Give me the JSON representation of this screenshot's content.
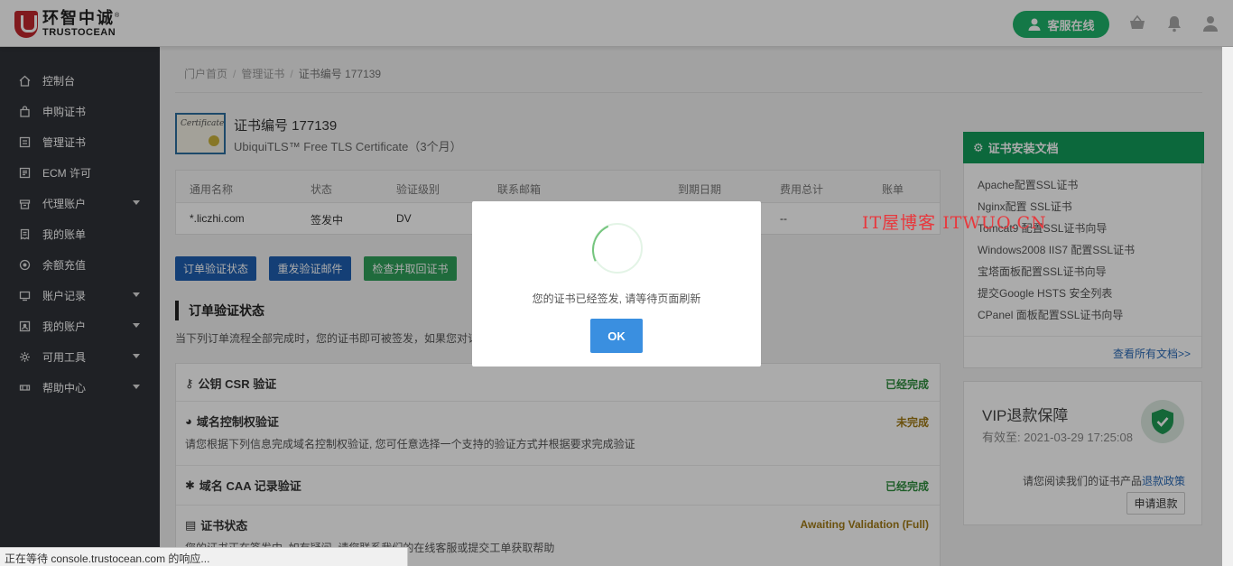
{
  "header": {
    "logo_cn": "环智中诚",
    "logo_en": "TRUSTOCEAN",
    "logo_mark": "®",
    "support_label": "客服在线",
    "icons": [
      "user-icon",
      "basket-icon",
      "bell-icon",
      "account-icon"
    ]
  },
  "sidebar": {
    "items": [
      {
        "label": "控制台",
        "icon": "home-icon",
        "dropdown": false
      },
      {
        "label": "申购证书",
        "icon": "bag-icon",
        "dropdown": false
      },
      {
        "label": "管理证书",
        "icon": "certificate-icon",
        "dropdown": false
      },
      {
        "label": "ECM 许可",
        "icon": "license-icon",
        "dropdown": false
      },
      {
        "label": "代理账户",
        "icon": "agent-icon",
        "dropdown": true
      },
      {
        "label": "我的账单",
        "icon": "bill-icon",
        "dropdown": false
      },
      {
        "label": "余额充值",
        "icon": "recharge-icon",
        "dropdown": false
      },
      {
        "label": "账户记录",
        "icon": "record-icon",
        "dropdown": true
      },
      {
        "label": "我的账户",
        "icon": "profile-icon",
        "dropdown": true
      },
      {
        "label": "可用工具",
        "icon": "tools-icon",
        "dropdown": true
      },
      {
        "label": "帮助中心",
        "icon": "help-icon",
        "dropdown": true
      }
    ]
  },
  "breadcrumb": {
    "home": "门户首页",
    "manage": "管理证书",
    "current": "证书编号 177139",
    "sep": "/"
  },
  "cert": {
    "badge_text": "Certificate",
    "title": "证书编号 177139",
    "subtitle": "UbiquiTLS™ Free TLS Certificate（3个月）"
  },
  "info_table": {
    "headers": [
      "通用名称",
      "状态",
      "验证级别",
      "联系邮箱",
      "到期日期",
      "费用总计",
      "账单"
    ],
    "row": [
      "*.liczhi.com",
      "签发中",
      "DV",
      "",
      "",
      "--",
      ""
    ]
  },
  "actions": {
    "order_status": "订单验证状态",
    "resend_email": "重发验证邮件",
    "check_retrieve": "检查并取回证书"
  },
  "section": {
    "title": "订单验证状态",
    "desc": "当下列订单流程全部完成时，您的证书即可被签发，如果您对订"
  },
  "verifications": [
    {
      "icon": "key-icon",
      "title": "公钥 CSR 验证",
      "status": "已经完成",
      "desc": ""
    },
    {
      "icon": "globe-icon",
      "title": "域名控制权验证",
      "status": "未完成",
      "desc": "请您根据下列信息完成域名控制权验证, 您可任意选择一个支持的验证方式并根据要求完成验证"
    },
    {
      "icon": "puzzle-icon",
      "title": "域名 CAA 记录验证",
      "status": "已经完成",
      "desc": ""
    },
    {
      "icon": "document-icon",
      "title": "证书状态",
      "status": "Awaiting Validation (Full)",
      "desc": "您的证书正在签发中, 如有疑问, 请您联系我们的在线客服或提交工单获取帮助"
    }
  ],
  "docs": {
    "title": "证书安装文档",
    "links": [
      "Apache配置SSL证书",
      "Nginx配置 SSL证书",
      "Tomcat9 配置SSL证书向导",
      "Windows2008 IIS7 配置SSL证书",
      "宝塔面板配置SSL证书向导",
      "提交Google HSTS 安全列表",
      "CPanel 面板配置SSL证书向导"
    ],
    "view_all": "查看所有文档>>"
  },
  "vip": {
    "title": "VIP退款保障",
    "valid": "有效至: 2021-03-29 17:25:08",
    "read_prefix": "请您阅读我们的证书产品",
    "policy_link": "退款政策",
    "refund_btn": "申请退款"
  },
  "watermark": "IT屋博客 ITWUO.CN",
  "modal": {
    "message": "您的证书已经签发, 请等待页面刷新",
    "ok": "OK"
  },
  "statusbar": "正在等待 console.trustocean.com 的响应...",
  "colors": {
    "brand_red": "#c0272d",
    "sidebar_bg": "#2f3238",
    "support_green": "#1fb46a",
    "primary_blue": "#1f5fb0",
    "success_green": "#2fa05a",
    "docs_green": "#139c5a",
    "status_done": "#2f8d3e",
    "status_pending": "#a07a15",
    "modal_ok": "#3a8fe0"
  }
}
